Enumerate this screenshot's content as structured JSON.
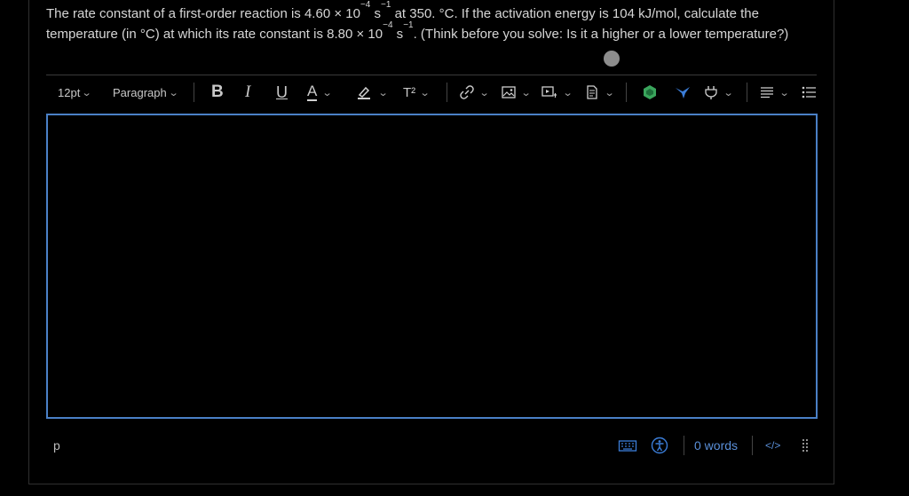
{
  "question": {
    "part1": "The rate constant of a first-order reaction is 4.60 × 10",
    "exp1": "−4",
    "part2": " s",
    "exp2": "−1",
    "part3": " at 350. °C.  If the activation energy is 104 kJ/mol, calculate the temperature (in °C) at which its rate constant is 8.80 × 10",
    "exp3": "−4",
    "part4": " s",
    "exp4": "−1",
    "part5": ". (Think before you solve: Is it a higher or a lower temperature?)"
  },
  "toolbar": {
    "font_size": "12pt",
    "block_format": "Paragraph",
    "bold": "B",
    "italic": "I",
    "underline": "U",
    "text_color": "A",
    "superscript": "T²"
  },
  "editor": {
    "content": ""
  },
  "statusbar": {
    "path": "p",
    "word_count": "0 words",
    "html_toggle": "</>"
  },
  "colors": {
    "background": "#000000",
    "editor_border": "#4a80c6",
    "text": "#d6d6d6",
    "accent_green": "#3aa55c",
    "accent_blue": "#3b7dd8"
  }
}
